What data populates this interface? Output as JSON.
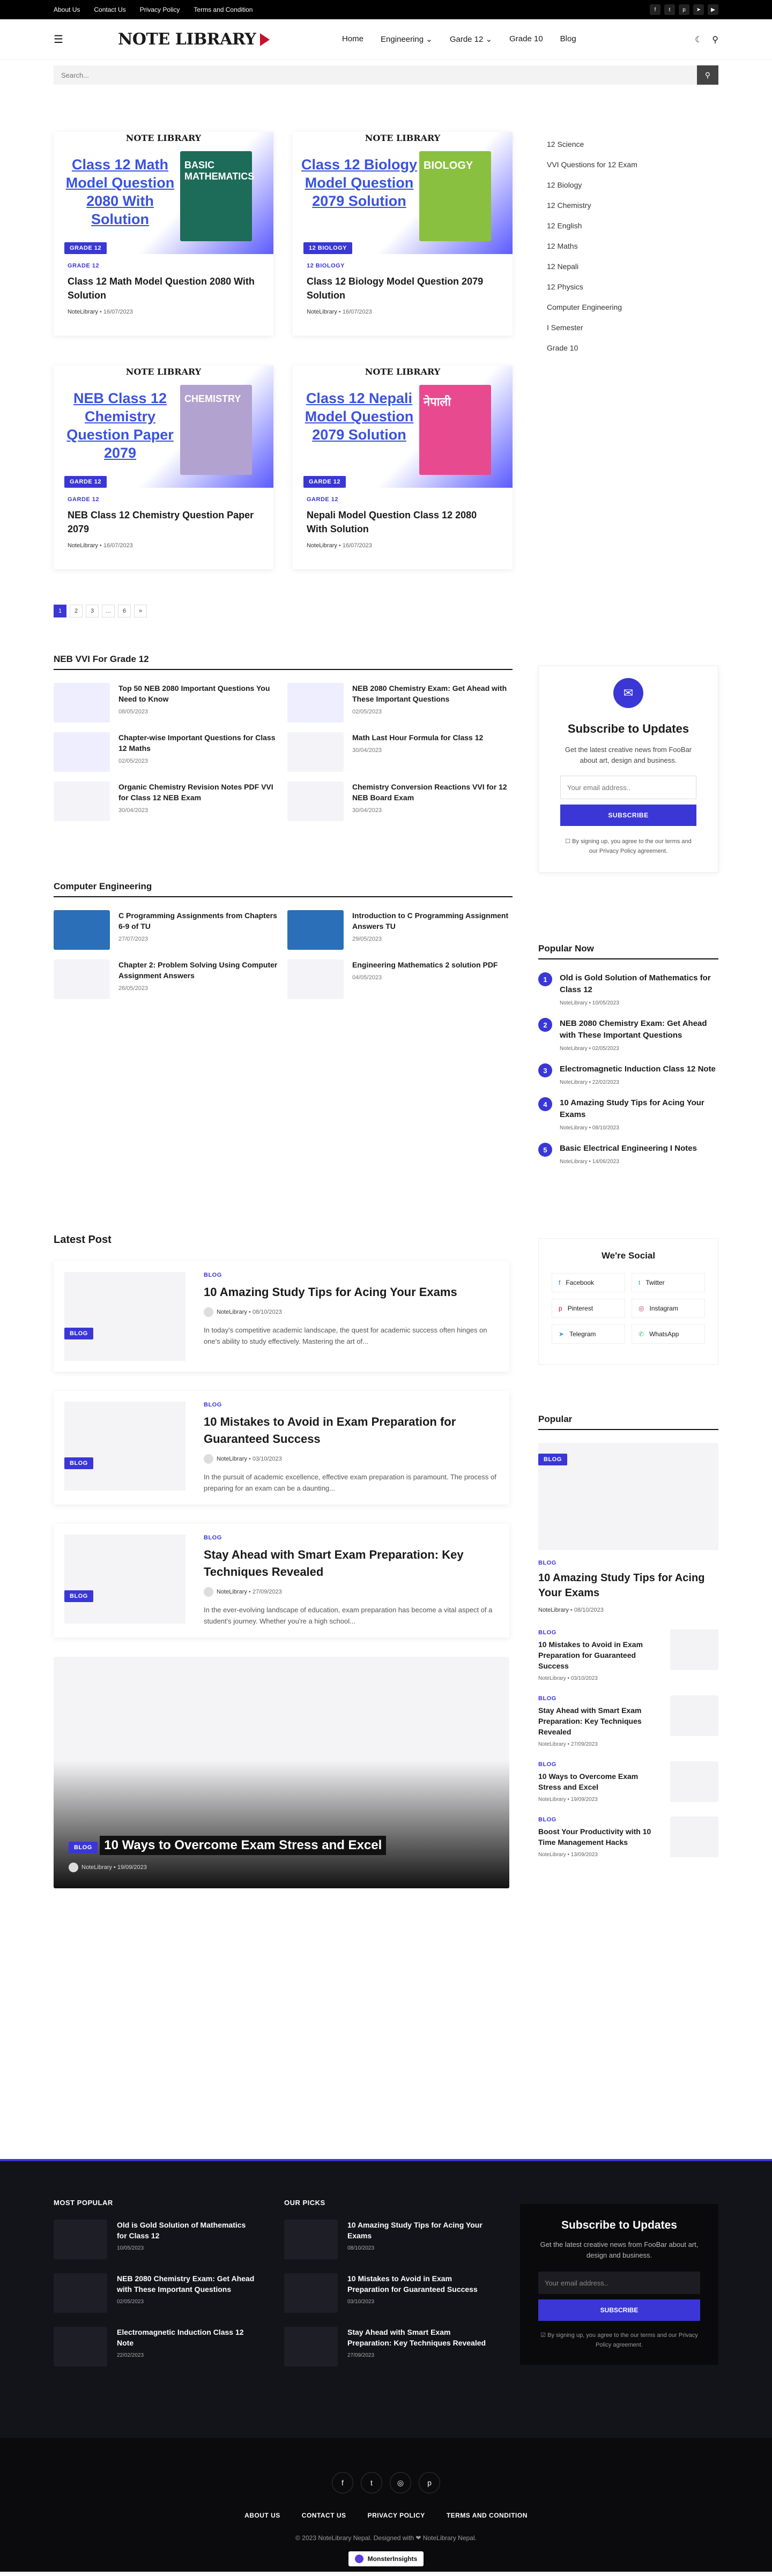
{
  "topbar": {
    "links": [
      "About Us",
      "Contact Us",
      "Privacy Policy",
      "Terms and Condition"
    ]
  },
  "header": {
    "logo": "NOTE LIBRARY",
    "nav": [
      {
        "label": "Home"
      },
      {
        "label": "Engineering",
        "caret": "⌄"
      },
      {
        "label": "Garde 12",
        "caret": "⌄"
      },
      {
        "label": "Grade 10"
      },
      {
        "label": "Blog"
      }
    ],
    "search_placeholder": "Search..."
  },
  "grid_posts": [
    {
      "category": "GRADE 12",
      "title": "Class 12 Math Model Question 2080 With Solution",
      "author": "NoteLibrary",
      "date": "16/07/2023",
      "thumb_title": "Class 12 Math Model Question 2080 With Solution",
      "book_color": "#1d6b59",
      "book_label": "BASIC MATHEMATICS"
    },
    {
      "category": "12 BIOLOGY",
      "title": "Class 12 Biology Model Question 2079 Solution",
      "author": "NoteLibrary",
      "date": "16/07/2023",
      "thumb_title": "Class 12 Biology Model Question 2079 Solution",
      "book_color": "#8ac040",
      "book_label": "BIOLOGY"
    },
    {
      "category": "GARDE 12",
      "title": "NEB Class 12 Chemistry Question Paper 2079",
      "author": "NoteLibrary",
      "date": "16/07/2023",
      "thumb_title": "NEB Class 12 Chemistry Question Paper 2079",
      "book_color": "#b2a2cf",
      "book_label": "CHEMISTRY"
    },
    {
      "category": "GARDE 12",
      "title": "Nepali Model Question Class 12 2080 With Solution",
      "author": "NoteLibrary",
      "date": "16/07/2023",
      "thumb_title": "Class 12 Nepali Model Question 2079 Solution",
      "book_color": "#e84a8f",
      "book_label": "नेपाली"
    }
  ],
  "thumb_brand": "NOTE LIBRARY",
  "sidebar_categories": [
    "12 Science",
    "VVI Questions for 12 Exam",
    "12 Biology",
    "12 Chemistry",
    "12 English",
    "12 Maths",
    "12 Nepali",
    "12 Physics",
    "Computer Engineering",
    "I Semester",
    "Grade 10"
  ],
  "pagination": [
    "1",
    "2",
    "3",
    "...",
    "6",
    "»"
  ],
  "neb_section": {
    "title": "NEB VVI For Grade 12",
    "posts": [
      {
        "title": "Top 50 NEB 2080 Important Questions You Need to Know",
        "date": "08/05/2023"
      },
      {
        "title": "NEB 2080 Chemistry Exam: Get Ahead with These Important Questions",
        "date": "02/05/2023"
      },
      {
        "title": "Chapter-wise Important Questions for Class 12 Maths",
        "date": "02/05/2023"
      },
      {
        "title": "Math Last Hour Formula for Class 12",
        "date": "30/04/2023"
      },
      {
        "title": "Organic Chemistry Revision Notes PDF VVI for Class 12 NEB Exam",
        "date": "30/04/2023"
      },
      {
        "title": "Chemistry Conversion Reactions VVI for 12 NEB Board Exam",
        "date": "30/04/2023"
      }
    ]
  },
  "ce_section": {
    "title": "Computer Engineering",
    "posts": [
      {
        "title": "C Programming Assignments from Chapters 6-9 of TU",
        "date": "27/07/2023"
      },
      {
        "title": "Introduction to C Programming Assignment Answers TU",
        "date": "29/05/2023"
      },
      {
        "title": "Chapter 2: Problem Solving Using Computer Assignment Answers",
        "date": "26/05/2023"
      },
      {
        "title": "Engineering Mathematics 2 solution PDF",
        "date": "04/05/2023"
      }
    ]
  },
  "subscribe": {
    "title": "Subscribe to Updates",
    "text": "Get the latest creative news from FooBar about art, design and business.",
    "placeholder": "Your email address..",
    "button": "SUBSCRIBE",
    "agree": "By signing up, you agree to the our terms and our Privacy Policy agreement."
  },
  "popular_now": {
    "title": "Popular Now",
    "items": [
      {
        "n": "1",
        "title": "Old is Gold Solution of Mathematics for Class 12",
        "author": "NoteLibrary",
        "date": "10/05/2023"
      },
      {
        "n": "2",
        "title": "NEB 2080 Chemistry Exam: Get Ahead with These Important Questions",
        "author": "NoteLibrary",
        "date": "02/05/2023"
      },
      {
        "n": "3",
        "title": "Electromagnetic Induction Class 12 Note",
        "author": "NoteLibrary",
        "date": "22/02/2023"
      },
      {
        "n": "4",
        "title": "10 Amazing Study Tips for Acing Your Exams",
        "author": "NoteLibrary",
        "date": "08/10/2023"
      },
      {
        "n": "5",
        "title": "Basic Electrical Engineering I Notes",
        "author": "NoteLibrary",
        "date": "14/06/2023"
      }
    ]
  },
  "latest": {
    "title": "Latest Post",
    "posts": [
      {
        "category": "BLOG",
        "title": "10 Amazing Study Tips for Acing Your Exams",
        "author": "NoteLibrary",
        "date": "08/10/2023",
        "excerpt": "In today's competitive academic landscape, the quest for academic success often hinges on one's ability to study effectively. Mastering the art of..."
      },
      {
        "category": "BLOG",
        "title": "10 Mistakes to Avoid in Exam Preparation for Guaranteed Success",
        "author": "NoteLibrary",
        "date": "03/10/2023",
        "excerpt": "In the pursuit of academic excellence, effective exam preparation is paramount. The process of preparing for an exam can be a daunting..."
      },
      {
        "category": "BLOG",
        "title": "Stay Ahead with Smart Exam Preparation: Key Techniques Revealed",
        "author": "NoteLibrary",
        "date": "27/09/2023",
        "excerpt": "In the ever-evolving landscape of education, exam preparation has become a vital aspect of a student's journey. Whether you're a high school..."
      }
    ],
    "big": {
      "category": "BLOG",
      "title": "10 Ways to Overcome Exam Stress and Excel",
      "author": "NoteLibrary",
      "date": "19/09/2023"
    }
  },
  "social": {
    "title": "We're Social",
    "items": [
      "Facebook",
      "Twitter",
      "Pinterest",
      "Instagram",
      "Telegram",
      "WhatsApp"
    ]
  },
  "popular": {
    "title": "Popular",
    "featured": {
      "category": "BLOG",
      "title": "10 Amazing Study Tips for Acing Your Exams",
      "author": "NoteLibrary",
      "date": "08/10/2023"
    },
    "items": [
      {
        "category": "BLOG",
        "title": "10 Mistakes to Avoid in Exam Preparation for Guaranteed Success",
        "author": "NoteLibrary",
        "date": "03/10/2023"
      },
      {
        "category": "BLOG",
        "title": "Stay Ahead with Smart Exam Preparation: Key Techniques Revealed",
        "author": "NoteLibrary",
        "date": "27/09/2023"
      },
      {
        "category": "BLOG",
        "title": "10 Ways to Overcome Exam Stress and Excel",
        "author": "NoteLibrary",
        "date": "19/09/2023"
      },
      {
        "category": "BLOG",
        "title": "Boost Your Productivity with 10 Time Management Hacks",
        "author": "NoteLibrary",
        "date": "13/09/2023"
      }
    ]
  },
  "footer": {
    "most_popular_title": "MOST POPULAR",
    "most_popular": [
      {
        "title": "Old is Gold Solution of Mathematics for Class 12",
        "date": "10/05/2023"
      },
      {
        "title": "NEB 2080 Chemistry Exam: Get Ahead with These Important Questions",
        "date": "02/05/2023"
      },
      {
        "title": "Electromagnetic Induction Class 12 Note",
        "date": "22/02/2023"
      }
    ],
    "our_picks_title": "OUR PICKS",
    "our_picks": [
      {
        "title": "10 Amazing Study Tips for Acing Your Exams",
        "date": "08/10/2023"
      },
      {
        "title": "10 Mistakes to Avoid in Exam Preparation for Guaranteed Success",
        "date": "03/10/2023"
      },
      {
        "title": "Stay Ahead with Smart Exam Preparation: Key Techniques Revealed",
        "date": "27/09/2023"
      }
    ],
    "subscribe": {
      "title": "Subscribe to Updates",
      "text": "Get the latest creative news from FooBar about art, design and business.",
      "placeholder": "Your email address..",
      "button": "SUBSCRIBE",
      "agree": "By signing up, you agree to the our terms and our Privacy Policy agreement."
    },
    "bottom_links": [
      "ABOUT US",
      "CONTACT US",
      "PRIVACY POLICY",
      "TERMS AND CONDITION"
    ],
    "copyright": "© 2023 NoteLibrary Nepal. Designed with ❤ NoteLibrary Nepal.",
    "badge": "MonsterInsights"
  },
  "colors": {
    "accent": "#3a37d6"
  }
}
